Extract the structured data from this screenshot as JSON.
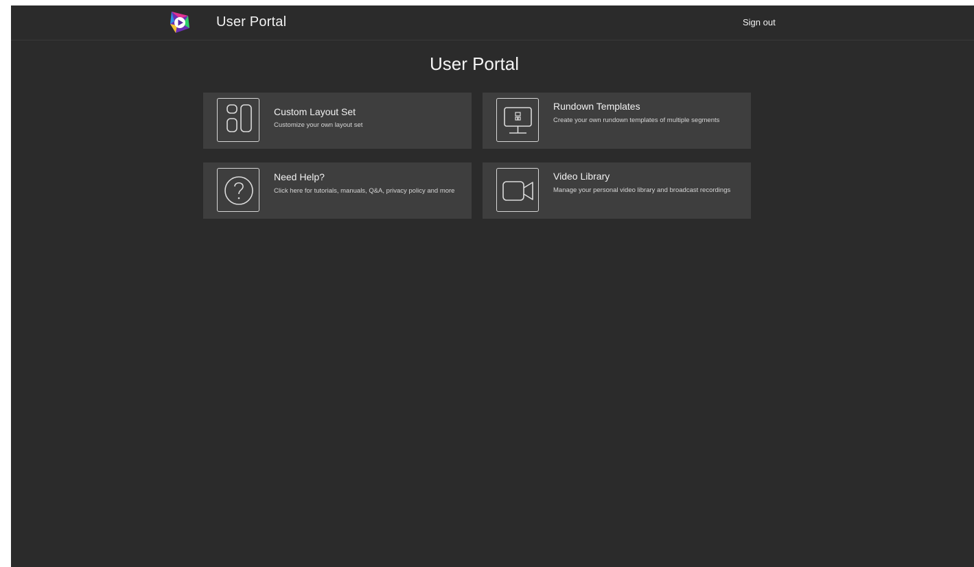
{
  "header": {
    "app_title": "User Portal",
    "sign_out_label": "Sign out",
    "logo_icon": "play-logo-icon"
  },
  "main": {
    "title": "User Portal",
    "cards": [
      {
        "title": "Custom Layout Set",
        "description": "Customize your own layout set",
        "icon": "layout-icon"
      },
      {
        "title": "Rundown Templates",
        "description": "Create your own rundown templates of multiple segments",
        "icon": "monitor-icon"
      },
      {
        "title": "Need Help?",
        "description": "Click here for tutorials, manuals, Q&A, privacy policy and more",
        "icon": "help-icon"
      },
      {
        "title": "Video Library",
        "description": "Manage your personal video library and broadcast recordings",
        "icon": "video-camera-icon"
      }
    ]
  },
  "colors": {
    "background": "#2b2b2b",
    "card": "#3e3e3e",
    "text": "#f2f2f2"
  }
}
